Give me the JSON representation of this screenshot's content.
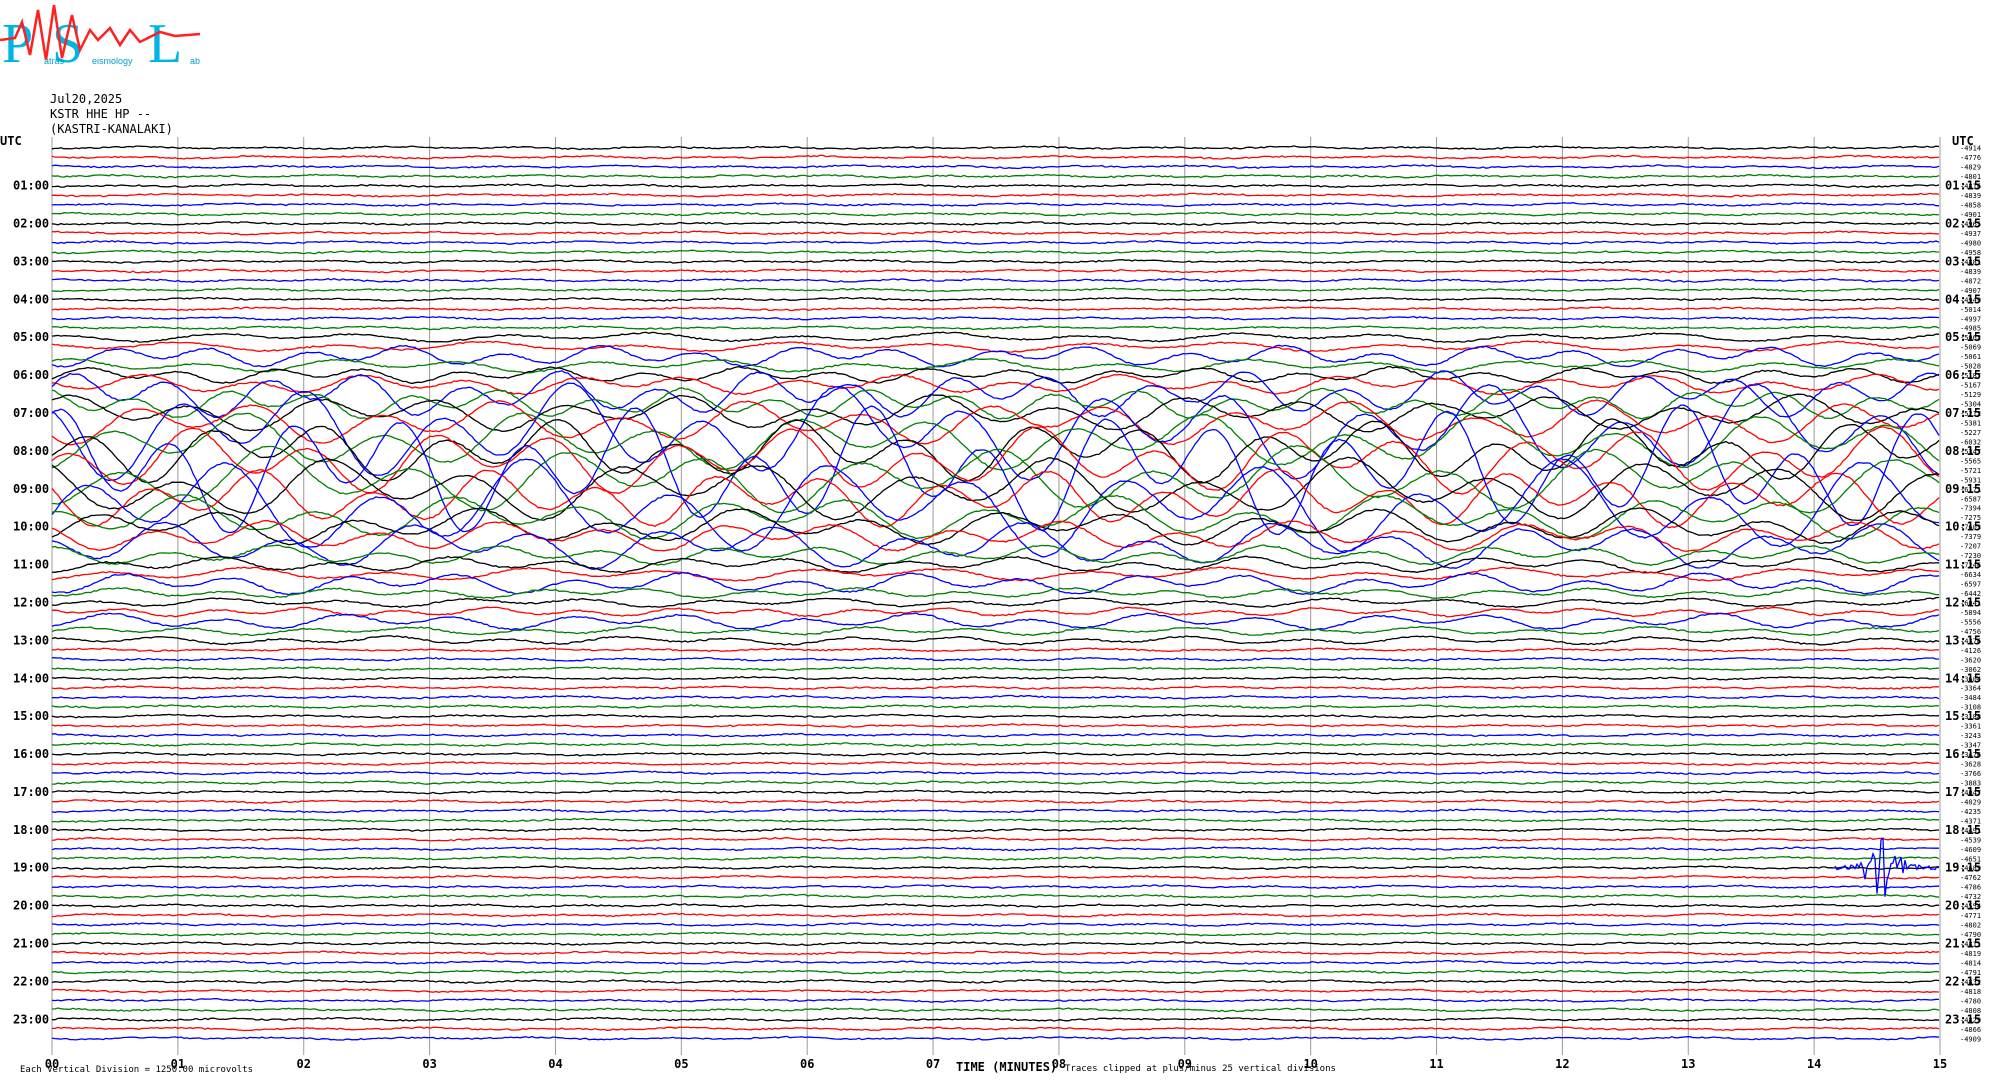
{
  "logo": {
    "text": "PSL",
    "small_words": [
      "atras",
      "eismology",
      "ab"
    ]
  },
  "header": {
    "date": "Jul20,2025",
    "station": "KSTR HHE HP --",
    "location": "(KASTRI-KANALAKI)"
  },
  "chart_data": {
    "type": "line",
    "title": "",
    "xlabel": "TIME (MINUTES)",
    "ylabel": "",
    "axis_left_label": "UTC",
    "axis_right_label": "UTC",
    "xlim": [
      0,
      15
    ],
    "x_ticks": [
      "00",
      "01",
      "02",
      "03",
      "04",
      "05",
      "06",
      "07",
      "08",
      "09",
      "10",
      "11",
      "12",
      "13",
      "14",
      "15"
    ],
    "left_hour_labels": [
      "01:00",
      "02:00",
      "03:00",
      "04:00",
      "05:00",
      "06:00",
      "07:00",
      "08:00",
      "09:00",
      "10:00",
      "11:00",
      "12:00",
      "13:00",
      "14:00",
      "15:00",
      "16:00",
      "17:00",
      "18:00",
      "19:00",
      "20:00",
      "21:00",
      "22:00",
      "23:00"
    ],
    "right_hour_labels": [
      "01:15",
      "02:15",
      "03:15",
      "04:15",
      "05:15",
      "06:15",
      "07:15",
      "08:15",
      "09:15",
      "10:15",
      "11:15",
      "12:15",
      "13:15",
      "14:15",
      "15:15",
      "16:15",
      "17:15",
      "18:15",
      "19:15",
      "20:15",
      "21:15",
      "22:15",
      "23:15"
    ],
    "trace_colors": [
      "#000000",
      "#ff0000",
      "#0000ff",
      "#007f00"
    ],
    "trace_offsets": [
      "-4914",
      "-4776",
      "-4829",
      "-4801",
      "-4816",
      "-4839",
      "-4858",
      "-4901",
      "-4965",
      "-4937",
      "-4980",
      "-4958",
      "-4881",
      "-4839",
      "-4872",
      "-4907",
      "-4949",
      "-5014",
      "-4997",
      "-4985",
      "-5062",
      "-5069",
      "-5061",
      "-5028",
      "-5187",
      "-5167",
      "-5129",
      "-5304",
      "-5212",
      "-5381",
      "-5227",
      "-6032",
      "-5347",
      "-5565",
      "-5721",
      "-5931",
      "-6171",
      "-6587",
      "-7394",
      "-7275",
      "-7603",
      "-7379",
      "-7207",
      "-7230",
      "-7246",
      "-6634",
      "-6597",
      "-6442",
      "-6041",
      "-5894",
      "-5556",
      "-4756",
      "-4376",
      "-4126",
      "-3620",
      "-3062",
      "-3604",
      "-3364",
      "-3484",
      "-3108",
      "-3188",
      "-3361",
      "-3243",
      "-3347",
      "-3476",
      "-3628",
      "-3766",
      "-3883",
      "-4047",
      "-4029",
      "-4235",
      "-4371",
      "-4491",
      "-4539",
      "-4609",
      "-4651",
      "-4689",
      "-4762",
      "-4786",
      "-4732",
      "-4554",
      "-4771",
      "-4802",
      "-4790",
      "-4811",
      "-4819",
      "-4814",
      "-4791",
      "-4832",
      "-4818",
      "-4780",
      "-4808",
      "-4829",
      "-4866",
      "-4909"
    ],
    "footer_left": "Each Vertical Division = 1250.00 microvolts",
    "clip_note": "Traces clipped at plus/minus 25 vertical divisions"
  }
}
